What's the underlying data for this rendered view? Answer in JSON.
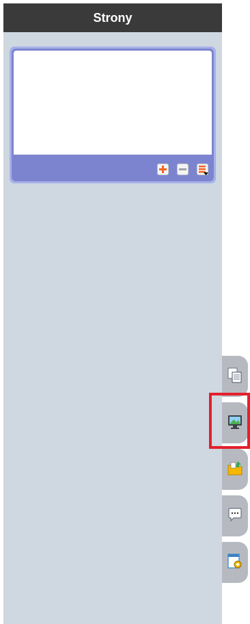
{
  "panel": {
    "title": "Strony"
  },
  "page_controls": [
    {
      "name": "add-page-button",
      "icon": "plus-icon",
      "color": "#f26522"
    },
    {
      "name": "remove-page-button",
      "icon": "minus-icon",
      "color": "#9ea3a8"
    },
    {
      "name": "page-menu-button",
      "icon": "list-menu-icon",
      "color": "#f26522"
    }
  ],
  "side_tabs": [
    {
      "name": "tab-pages",
      "icon": "pages-icon",
      "selected": false
    },
    {
      "name": "tab-gallery",
      "icon": "display-icon",
      "selected": true
    },
    {
      "name": "tab-attachments",
      "icon": "folder-icon",
      "selected": false
    },
    {
      "name": "tab-comments",
      "icon": "speech-bubble-icon",
      "selected": false
    },
    {
      "name": "tab-properties",
      "icon": "settings-gear-icon",
      "selected": false
    }
  ],
  "colors": {
    "panel_bg": "#cfd7e0",
    "header_bg": "#3a3a3a",
    "frame_outer": "#a6b1ea",
    "frame_inner": "#7d84cf",
    "accent_orange": "#f26522",
    "tab_bg": "#b6bac0",
    "selection_red": "#e3202c"
  }
}
